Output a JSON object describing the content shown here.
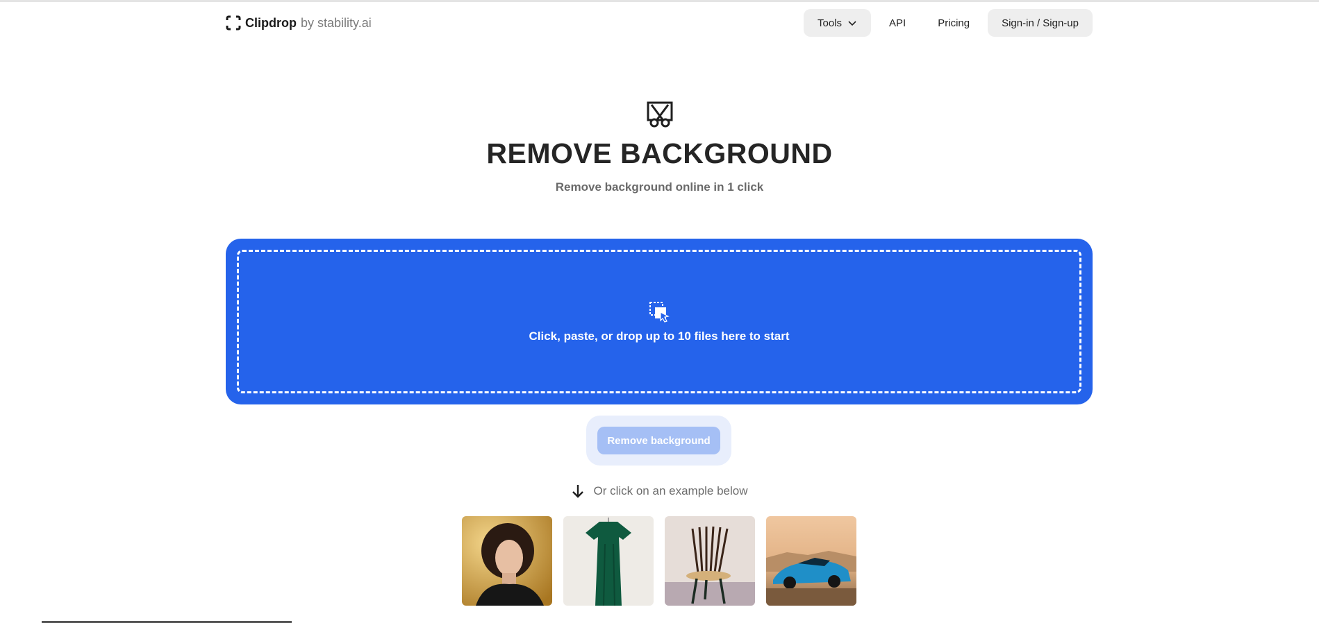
{
  "header": {
    "brand": "Clipdrop",
    "brand_suffix": "by stability.ai",
    "nav": {
      "tools_label": "Tools",
      "api_label": "API",
      "pricing_label": "Pricing",
      "signin_label": "Sign-in / Sign-up"
    }
  },
  "hero": {
    "icon": "cut-image-icon",
    "title": "REMOVE BACKGROUND",
    "subtitle": "Remove background online in 1 click"
  },
  "dropzone": {
    "icon": "select-cursor-icon",
    "text": "Click, paste, or drop up to 10 files here to start"
  },
  "action": {
    "button_label": "Remove background"
  },
  "examples": {
    "label": "Or click on an example below",
    "items": [
      {
        "icon": "portrait-woman-thumbnail"
      },
      {
        "icon": "green-dress-thumbnail"
      },
      {
        "icon": "wooden-chair-thumbnail"
      },
      {
        "icon": "blue-car-thumbnail"
      }
    ]
  },
  "colors": {
    "accent": "#2563eb",
    "button_disabled": "#a5bff5",
    "button_wrap": "#e8eefc",
    "pill": "#eeeeee"
  }
}
